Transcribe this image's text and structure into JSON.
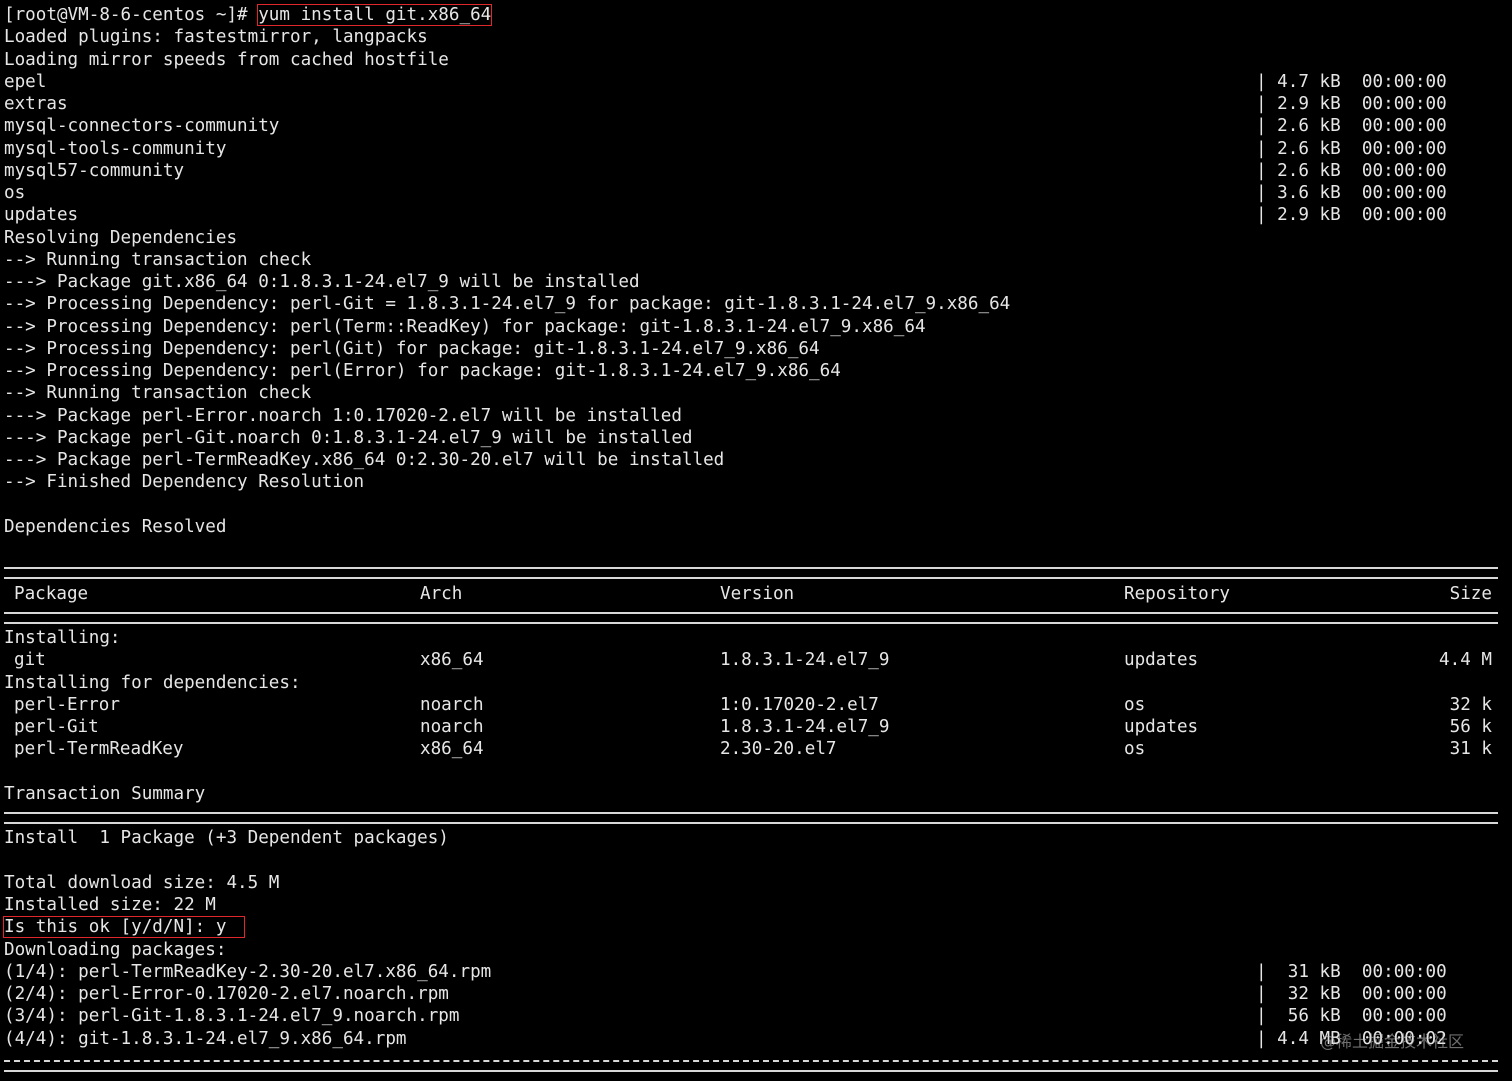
{
  "prompt": "[root@VM-8-6-centos ~]# ",
  "command": "yum install git.x86_64",
  "log_head": [
    "Loaded plugins: fastestmirror, langpacks",
    "Loading mirror speeds from cached hostfile"
  ],
  "repos": [
    {
      "name": "epel",
      "info": "| 4.7 kB  00:00:00"
    },
    {
      "name": "extras",
      "info": "| 2.9 kB  00:00:00"
    },
    {
      "name": "mysql-connectors-community",
      "info": "| 2.6 kB  00:00:00"
    },
    {
      "name": "mysql-tools-community",
      "info": "| 2.6 kB  00:00:00"
    },
    {
      "name": "mysql57-community",
      "info": "| 2.6 kB  00:00:00"
    },
    {
      "name": "os",
      "info": "| 3.6 kB  00:00:00"
    },
    {
      "name": "updates",
      "info": "| 2.9 kB  00:00:00"
    }
  ],
  "resolve_log": [
    "Resolving Dependencies",
    "--> Running transaction check",
    "---> Package git.x86_64 0:1.8.3.1-24.el7_9 will be installed",
    "--> Processing Dependency: perl-Git = 1.8.3.1-24.el7_9 for package: git-1.8.3.1-24.el7_9.x86_64",
    "--> Processing Dependency: perl(Term::ReadKey) for package: git-1.8.3.1-24.el7_9.x86_64",
    "--> Processing Dependency: perl(Git) for package: git-1.8.3.1-24.el7_9.x86_64",
    "--> Processing Dependency: perl(Error) for package: git-1.8.3.1-24.el7_9.x86_64",
    "--> Running transaction check",
    "---> Package perl-Error.noarch 1:0.17020-2.el7 will be installed",
    "---> Package perl-Git.noarch 0:1.8.3.1-24.el7_9 will be installed",
    "---> Package perl-TermReadKey.x86_64 0:2.30-20.el7 will be installed",
    "--> Finished Dependency Resolution"
  ],
  "deps_resolved": "Dependencies Resolved",
  "table": {
    "headers": {
      "package": "Package",
      "arch": "Arch",
      "version": "Version",
      "repository": "Repository",
      "size": "Size"
    },
    "installing_label": "Installing:",
    "installing": [
      {
        "package": "git",
        "arch": "x86_64",
        "version": "1.8.3.1-24.el7_9",
        "repository": "updates",
        "size": "4.4 M"
      }
    ],
    "deps_label": "Installing for dependencies:",
    "deps": [
      {
        "package": "perl-Error",
        "arch": "noarch",
        "version": "1:0.17020-2.el7",
        "repository": "os",
        "size": "32 k"
      },
      {
        "package": "perl-Git",
        "arch": "noarch",
        "version": "1.8.3.1-24.el7_9",
        "repository": "updates",
        "size": "56 k"
      },
      {
        "package": "perl-TermReadKey",
        "arch": "x86_64",
        "version": "2.30-20.el7",
        "repository": "os",
        "size": "31 k"
      }
    ]
  },
  "summary": {
    "title": "Transaction Summary",
    "install_line": "Install  1 Package (+3 Dependent packages)",
    "total_download": "Total download size: 4.5 M",
    "installed_size": "Installed size: 22 M",
    "confirm_prompt": "Is this ok [y/d/N]: y",
    "downloading": "Downloading packages:"
  },
  "downloads": [
    {
      "file": "(1/4): perl-TermReadKey-2.30-20.el7.x86_64.rpm",
      "info": "|  31 kB  00:00:00"
    },
    {
      "file": "(2/4): perl-Error-0.17020-2.el7.noarch.rpm",
      "info": "|  32 kB  00:00:00"
    },
    {
      "file": "(3/4): perl-Git-1.8.3.1-24.el7_9.noarch.rpm",
      "info": "|  56 kB  00:00:00"
    },
    {
      "file": "(4/4): git-1.8.3.1-24.el7_9.x86_64.rpm",
      "info": "| 4.4 MB  00:00:02"
    }
  ],
  "watermark": "@稀土掘金技术社区",
  "colors": {
    "background": "#000000",
    "text": "#e6e6e6",
    "highlight_box": "#e0272b"
  }
}
